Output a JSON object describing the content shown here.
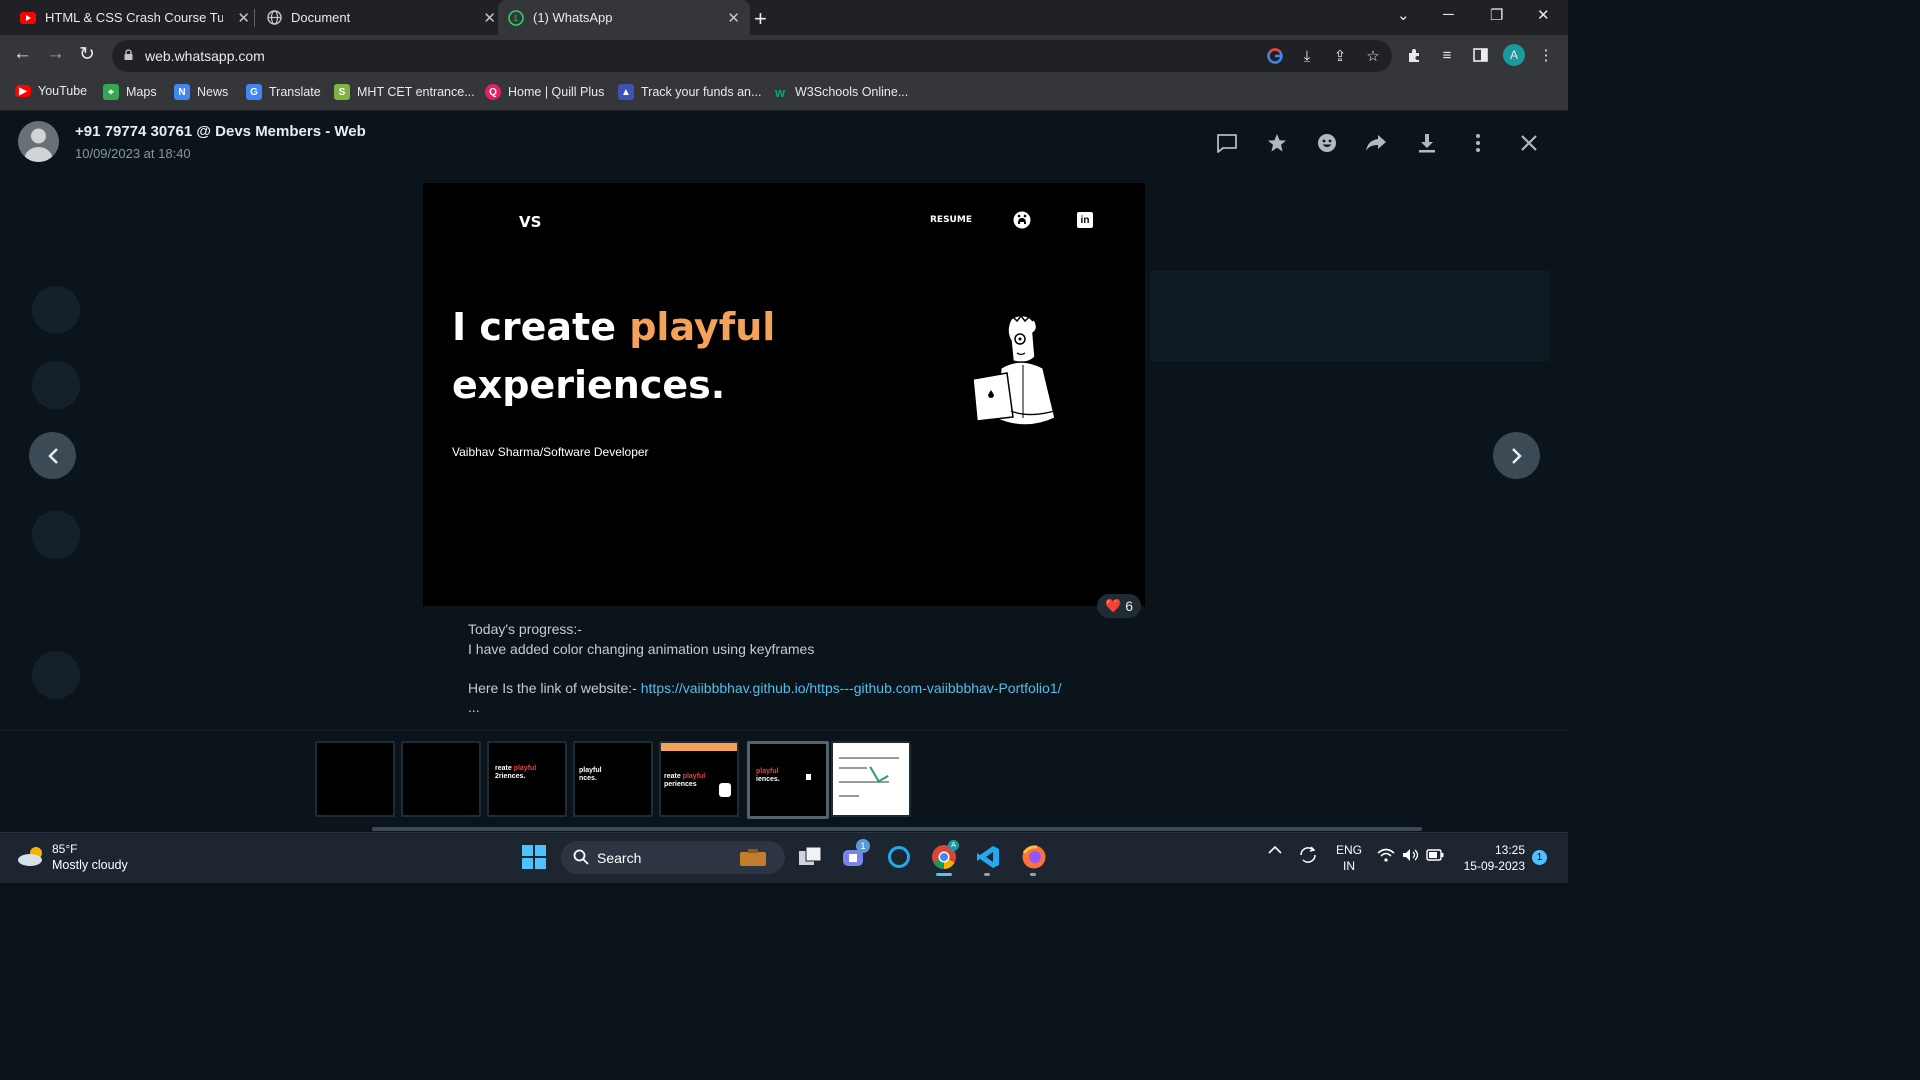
{
  "browser": {
    "tabs": [
      {
        "title": "HTML & CSS Crash Course Tutori",
        "favicon": "youtube-icon"
      },
      {
        "title": "Document",
        "favicon": "globe-icon"
      },
      {
        "title": "(1) WhatsApp",
        "favicon": "whatsapp-icon"
      }
    ],
    "url": "web.whatsapp.com",
    "profile_initial": "A",
    "bookmarks": [
      {
        "label": "YouTube",
        "icon": "youtube-icon"
      },
      {
        "label": "Maps",
        "icon": "maps-icon"
      },
      {
        "label": "News",
        "icon": "news-icon"
      },
      {
        "label": "Translate",
        "icon": "translate-icon"
      },
      {
        "label": "MHT CET entrance...",
        "icon": "s-icon"
      },
      {
        "label": "Home | Quill Plus",
        "icon": "quill-icon"
      },
      {
        "label": "Track your funds an...",
        "icon": "funds-icon"
      },
      {
        "label": "W3Schools Online...",
        "icon": "w3schools-icon"
      }
    ]
  },
  "viewer": {
    "sender": "+91 79774 30761 @ Devs Members - Web",
    "timestamp": "10/09/2023 at 18:40",
    "media": {
      "logo": "VS",
      "nav_resume": "RESUME",
      "headline_1": "I create ",
      "headline_accent": "playful",
      "headline_2": "experiences.",
      "subline": "Vaibhav Sharma/Software Developer"
    },
    "reaction": {
      "emoji": "❤️",
      "count": "6"
    },
    "caption": {
      "line1": "Today's progress:-",
      "line2": "I have added color changing animation using keyframes",
      "line3_prefix": "Here Is the link of website:- ",
      "link": "https://vaiibbbhav.github.io/https---github.com-vaiibbbhav-Portfolio1/",
      "more": "..."
    },
    "thumb_texts": [
      {
        "pre": "",
        "accent": "",
        "post": ""
      },
      {
        "pre": "",
        "accent": "",
        "post": ""
      },
      {
        "pre": "reate ",
        "accent": "playful",
        "post": "2riences."
      },
      {
        "pre": "",
        "accent": "playful",
        "post": "nces."
      },
      {
        "pre": "reate ",
        "accent": "playful",
        "post": "periences"
      },
      {
        "pre": "",
        "accent": "playful",
        "post": "iences."
      },
      {
        "pre": "",
        "accent": "",
        "post": ""
      }
    ]
  },
  "taskbar": {
    "weather_temp": "85°F",
    "weather_desc": "Mostly cloudy",
    "search_label": "Search",
    "lang_top": "ENG",
    "lang_bottom": "IN",
    "time": "13:25",
    "date": "15-09-2023",
    "teams_badge": "1",
    "notification_badge": "1"
  },
  "colors": {
    "accent": "#f4a259",
    "link": "#53bdeb",
    "whatsapp_bg": "#0b141a"
  }
}
